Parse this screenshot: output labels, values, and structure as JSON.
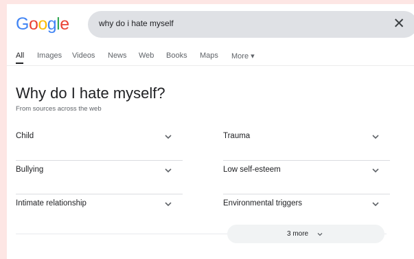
{
  "logo": {
    "letters": [
      {
        "ch": "G",
        "color": "#4285f4"
      },
      {
        "ch": "o",
        "color": "#ea4335"
      },
      {
        "ch": "o",
        "color": "#fbbc05"
      },
      {
        "ch": "g",
        "color": "#4285f4"
      },
      {
        "ch": "l",
        "color": "#34a853"
      },
      {
        "ch": "e",
        "color": "#ea4335"
      }
    ]
  },
  "search": {
    "query": "why do i hate myself",
    "clear_icon": "close-icon"
  },
  "tabs": [
    {
      "label": "All",
      "active": true
    },
    {
      "label": "Images"
    },
    {
      "label": "Videos"
    },
    {
      "label": "News"
    },
    {
      "label": "Web"
    },
    {
      "label": "Books"
    },
    {
      "label": "Maps"
    },
    {
      "label": "More ▾"
    }
  ],
  "main": {
    "title": "Why do I hate myself?",
    "subtitle": "From sources across the web",
    "items": [
      {
        "label": "Child"
      },
      {
        "label": "Trauma"
      },
      {
        "label": "Bullying"
      },
      {
        "label": "Low self-esteem"
      },
      {
        "label": "Intimate relationship"
      },
      {
        "label": "Environmental triggers"
      }
    ],
    "more_label": "3 more"
  },
  "colors": {
    "background": "#fde6e4",
    "search_bg": "#dfe1e5"
  }
}
